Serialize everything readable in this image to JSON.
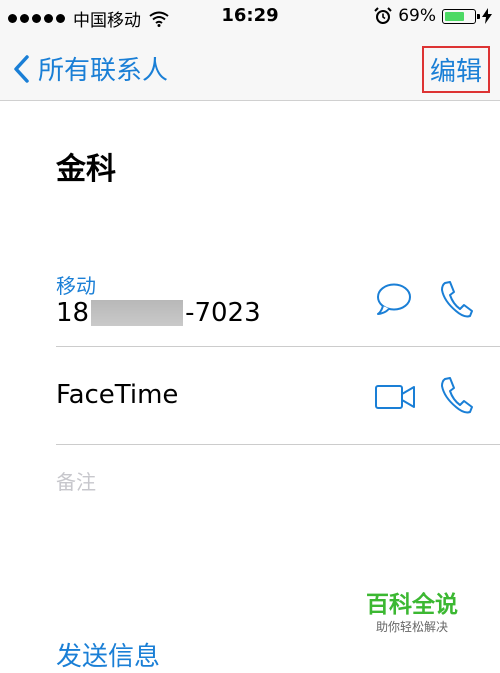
{
  "status_bar": {
    "carrier": "中国移动",
    "time": "16:29",
    "battery_percent": "69%",
    "battery_level": 0.69
  },
  "nav": {
    "back_label": "所有联系人",
    "edit_label": "编辑",
    "accent_color": "#1a7fd6",
    "highlight_color": "#d33333"
  },
  "contact": {
    "name": "金科",
    "phone_label": "移动",
    "phone_prefix": "18",
    "phone_suffix": "-7023",
    "facetime_label": "FaceTime",
    "notes_label": "备注",
    "send_message_label": "发送信息"
  },
  "icons": {
    "message": "message-bubble-icon",
    "call": "phone-icon",
    "video": "video-camera-icon"
  },
  "watermark": {
    "title": "百科全说",
    "subtitle": "助你轻松解决"
  }
}
